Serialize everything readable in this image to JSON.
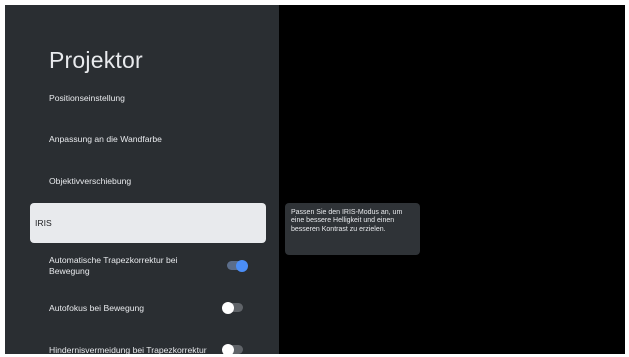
{
  "screen": {
    "title": "Projektor",
    "items": [
      {
        "label": "Positionseinstellung"
      },
      {
        "label": "Anpassung an die Wandfarbe"
      },
      {
        "label": "Objektivverschiebung"
      },
      {
        "label": "IRIS",
        "selected": true
      },
      {
        "label": "Automatische Trapezkorrektur bei Bewegung",
        "toggle": "on"
      },
      {
        "label": "Autofokus bei Bewegung",
        "toggle": "off"
      },
      {
        "label": "Hindernisvermeidung bei Trapezkorrektur",
        "toggle": "off"
      }
    ],
    "tooltip": "Passen Sie den IRIS-Modus an, um eine bessere Helligkeit und einen besseren Kontrast zu erzielen."
  },
  "colors": {
    "panel_bg": "#2a2e32",
    "selected_bg": "#e8eaed",
    "toggle_on": "#4b8ef7"
  }
}
